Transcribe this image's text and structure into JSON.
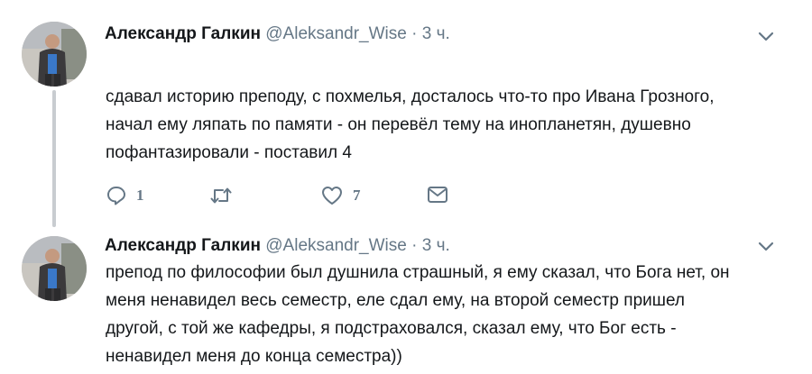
{
  "tweets": [
    {
      "name": "Александр Галкин",
      "handle": "@Aleksandr_Wise",
      "separator": "·",
      "time": "3 ч.",
      "text_lines": [
        "сдавал историю преподу, с похмелья, досталось что-то про Ивана Грозного,",
        "начал ему ляпать по памяти - он перевёл тему на инопланетян, душевно",
        "пофантазировали - поставил 4"
      ],
      "actions": {
        "reply_icon": "reply-icon",
        "reply_count": "1",
        "retweet_icon": "retweet-icon",
        "like_icon": "heart-icon",
        "like_count": "7",
        "message_icon": "envelope-icon"
      }
    },
    {
      "name": "Александр Галкин",
      "handle": "@Aleksandr_Wise",
      "separator": "·",
      "time": "3 ч.",
      "text_lines": [
        "препод по философии был душнила страшный, я ему сказал, что Бога нет, он",
        "меня ненавидел весь семестр, еле сдал ему, на второй семестр пришел",
        "другой, с той же кафедры, я подстраховался, сказал ему, что Бог есть -",
        "ненавидел меня до конца семестра))"
      ]
    }
  ],
  "colors": {
    "text": "#14171a",
    "secondary": "#657786",
    "thread_line": "#c8ccd0"
  }
}
